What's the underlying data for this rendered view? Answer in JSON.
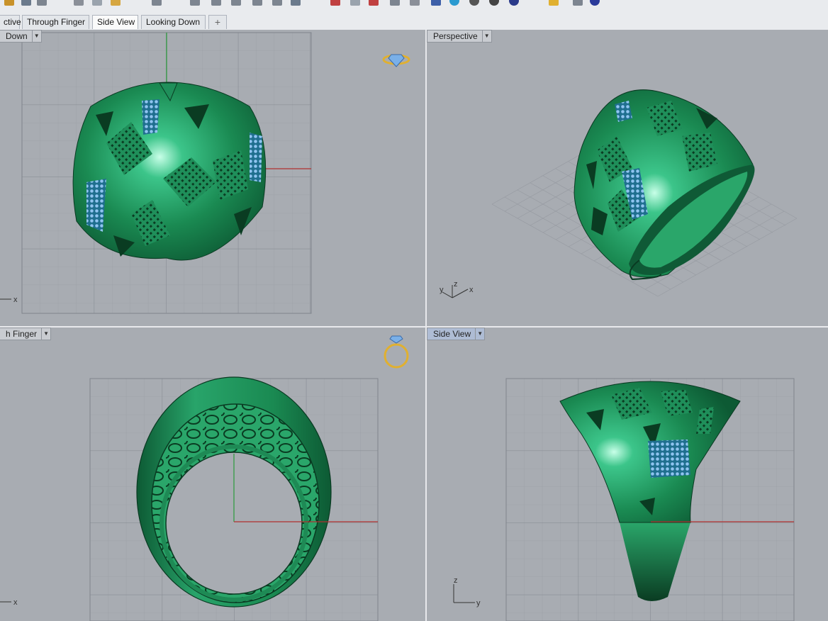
{
  "tabs": [
    {
      "label": "ctive",
      "active": false
    },
    {
      "label": "Through Finger",
      "active": false
    },
    {
      "label": "Side View",
      "active": true
    },
    {
      "label": "Looking Down",
      "active": false
    }
  ],
  "add_tab_icon": "plus-icon",
  "viewports": {
    "top_left": {
      "label": "Down",
      "axis_x": "x"
    },
    "top_right": {
      "label": "Perspective",
      "axis_x": "x",
      "axis_y": "y",
      "axis_z": "z"
    },
    "bottom_left": {
      "label": "h Finger",
      "axis_x": "x"
    },
    "bottom_right": {
      "label": "Side View",
      "axis_y": "y",
      "axis_z": "z"
    }
  },
  "colors": {
    "viewport_bg": "#a8acb2",
    "model_green": "#1e8a55",
    "x_axis": "#b03030",
    "y_axis": "#2a9a3a",
    "gem_blue": "#7ab0e8",
    "icon_gold": "#e0b030"
  }
}
